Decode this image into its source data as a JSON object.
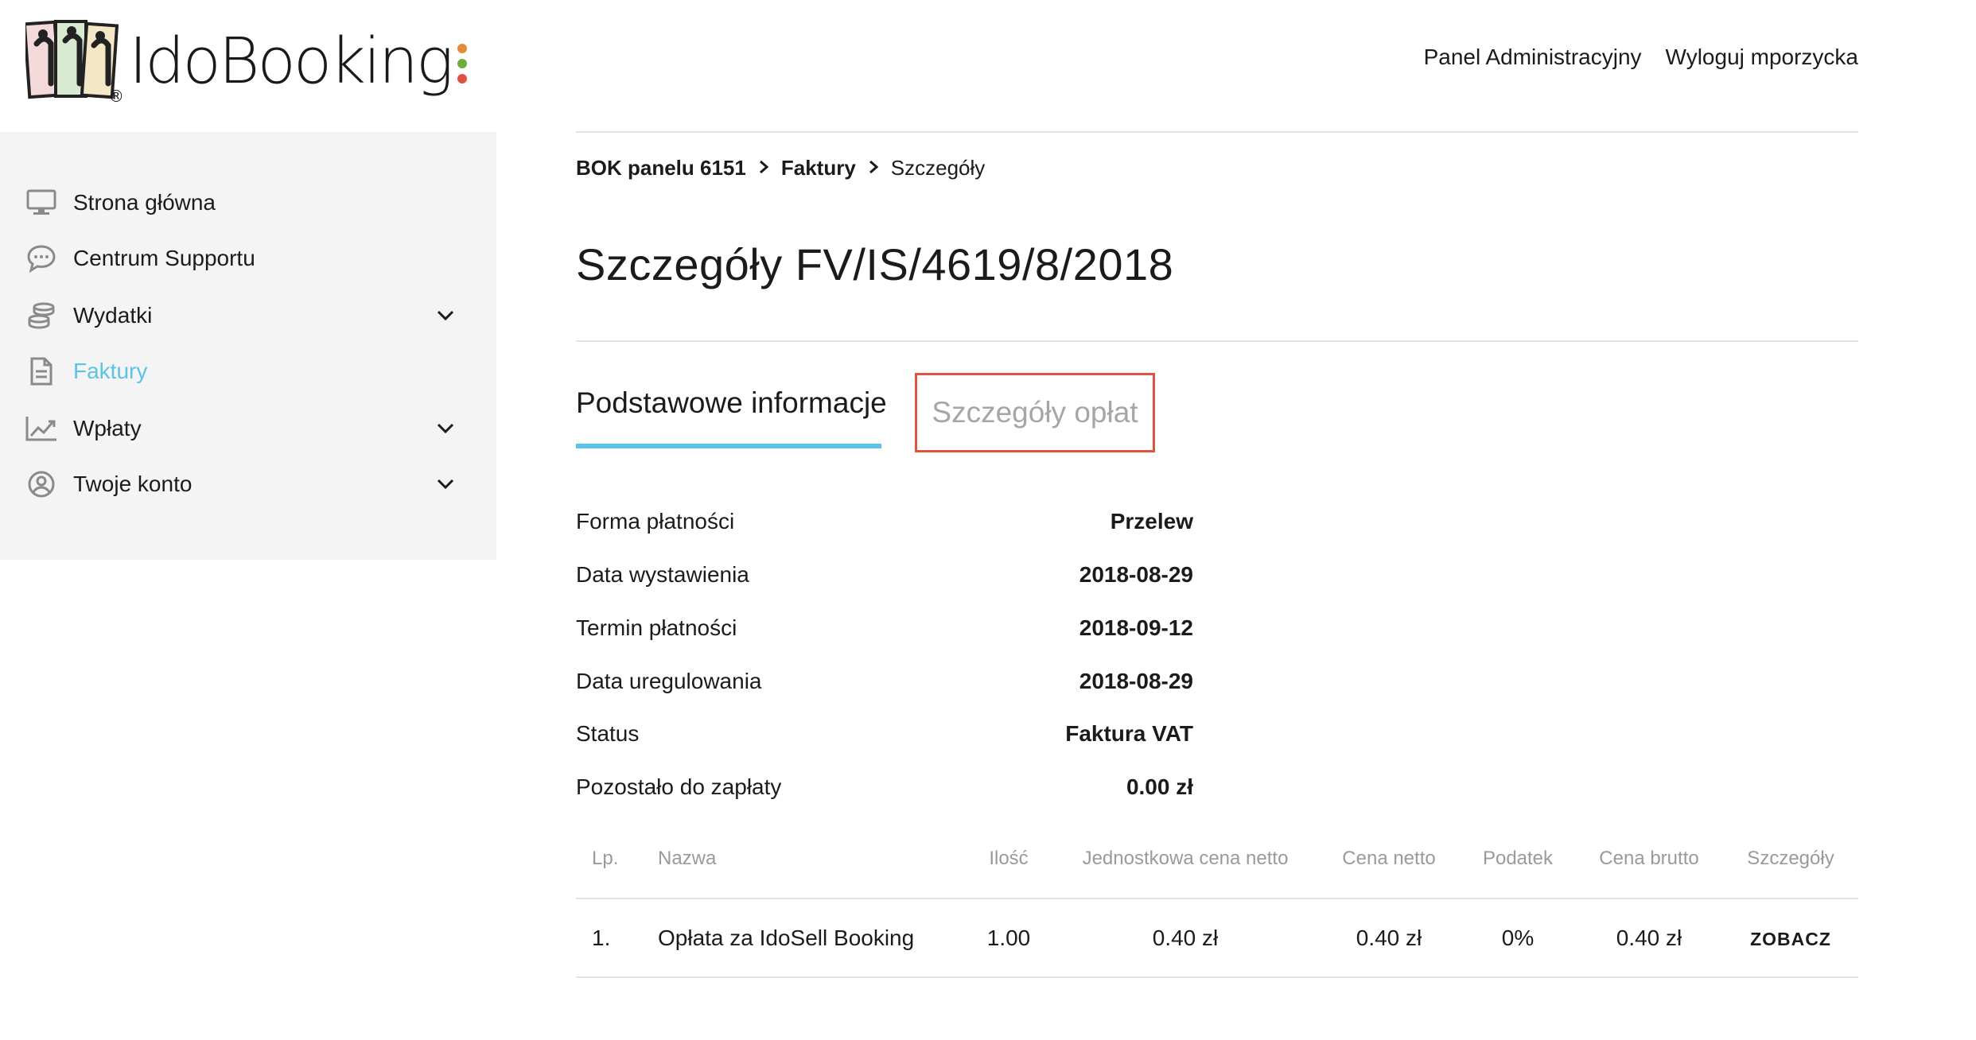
{
  "logo": {
    "text": "IdoBooking",
    "reg": "®"
  },
  "topnav": {
    "admin": "Panel Administracyjny",
    "logout": "Wyloguj mporzycka"
  },
  "sidebar": {
    "items": [
      {
        "label": "Strona główna",
        "icon": "monitor-icon"
      },
      {
        "label": "Centrum Supportu",
        "icon": "chat-icon"
      },
      {
        "label": "Wydatki",
        "icon": "coins-icon",
        "expandable": true
      },
      {
        "label": "Faktury",
        "icon": "document-icon",
        "active": true
      },
      {
        "label": "Wpłaty",
        "icon": "chart-icon",
        "expandable": true
      },
      {
        "label": "Twoje konto",
        "icon": "user-circle-icon",
        "expandable": true
      }
    ]
  },
  "breadcrumb": {
    "b1": "BOK panelu 6151",
    "b2": "Faktury",
    "b3": "Szczegóły"
  },
  "page": {
    "title": "Szczegóły FV/IS/4619/8/2018"
  },
  "tabs": {
    "basic": "Podstawowe informacje",
    "fees": "Szczegóły opłat"
  },
  "info": [
    {
      "label": "Forma płatności",
      "value": "Przelew"
    },
    {
      "label": "Data wystawienia",
      "value": "2018-08-29"
    },
    {
      "label": "Termin płatności",
      "value": "2018-09-12"
    },
    {
      "label": "Data uregulowania",
      "value": "2018-08-29"
    },
    {
      "label": "Status",
      "value": "Faktura VAT"
    },
    {
      "label": "Pozostało do zapłaty",
      "value": "0.00 zł"
    }
  ],
  "table": {
    "headers": {
      "lp": "Lp.",
      "name": "Nazwa",
      "qty": "Ilość",
      "unit": "Jednostkowa cena netto",
      "net": "Cena netto",
      "tax": "Podatek",
      "gross": "Cena brutto",
      "details": "Szczegóły"
    },
    "rows": [
      {
        "lp": "1.",
        "name": "Opłata za IdoSell Booking",
        "qty": "1.00",
        "unit": "0.40 zł",
        "net": "0.40 zł",
        "tax": "0%",
        "gross": "0.40 zł",
        "details": "ZOBACZ"
      }
    ]
  },
  "colors": {
    "accent": "#5bc3e6",
    "highlight": "#e0523f"
  }
}
